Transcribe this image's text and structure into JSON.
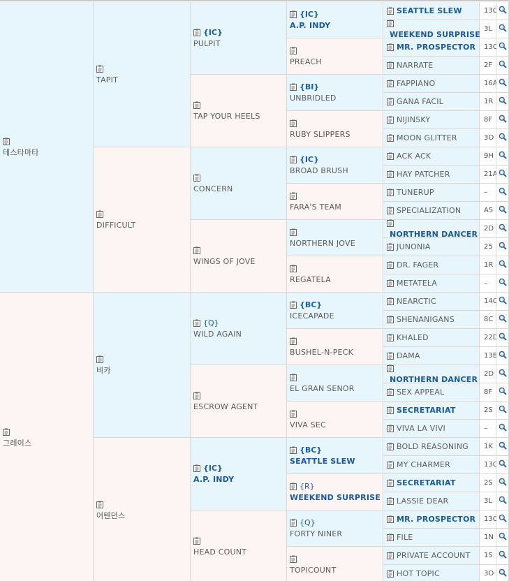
{
  "pedigree": [
    {
      "name": "테스타마타",
      "hl": false,
      "badge": "",
      "children": [
        {
          "name": "TAPIT",
          "hl": false,
          "badge": "",
          "children": [
            {
              "name": "PULPIT",
              "hl": false,
              "badge": "{IC}",
              "children": [
                {
                  "name": "A.P. INDY",
                  "hl": true,
                  "badge": "{IC}",
                  "children": [
                    {
                      "name": "SEATTLE SLEW",
                      "hl": true,
                      "code": "13C"
                    },
                    {
                      "name": "WEEKEND SURPRISE",
                      "hl": true,
                      "code": "3L"
                    }
                  ]
                },
                {
                  "name": "PREACH",
                  "hl": false,
                  "badge": "",
                  "children": [
                    {
                      "name": "MR. PROSPECTOR",
                      "hl": true,
                      "code": "13C"
                    },
                    {
                      "name": "NARRATE",
                      "hl": false,
                      "code": "2F"
                    }
                  ]
                }
              ]
            },
            {
              "name": "TAP YOUR HEELS",
              "hl": false,
              "badge": "",
              "children": [
                {
                  "name": "UNBRIDLED",
                  "hl": false,
                  "badge": "{BI}",
                  "children": [
                    {
                      "name": "FAPPIANO",
                      "hl": false,
                      "code": "16A"
                    },
                    {
                      "name": "GANA FACIL",
                      "hl": false,
                      "code": "1R"
                    }
                  ]
                },
                {
                  "name": "RUBY SLIPPERS",
                  "hl": false,
                  "badge": "",
                  "children": [
                    {
                      "name": "NIJINSKY",
                      "hl": false,
                      "code": "8F"
                    },
                    {
                      "name": "MOON GLITTER",
                      "hl": false,
                      "code": "3O"
                    }
                  ]
                }
              ]
            }
          ]
        },
        {
          "name": "DIFFICULT",
          "hl": false,
          "badge": "",
          "children": [
            {
              "name": "CONCERN",
              "hl": false,
              "badge": "",
              "children": [
                {
                  "name": "BROAD BRUSH",
                  "hl": false,
                  "badge": "{IC}",
                  "children": [
                    {
                      "name": "ACK ACK",
                      "hl": false,
                      "code": "9H"
                    },
                    {
                      "name": "HAY PATCHER",
                      "hl": false,
                      "code": "21A"
                    }
                  ]
                },
                {
                  "name": "FARA'S TEAM",
                  "hl": false,
                  "badge": "",
                  "children": [
                    {
                      "name": "TUNERUP",
                      "hl": false,
                      "code": "–"
                    },
                    {
                      "name": "SPECIALIZATION",
                      "hl": false,
                      "code": "A5"
                    }
                  ]
                }
              ]
            },
            {
              "name": "WINGS OF JOVE",
              "hl": false,
              "badge": "",
              "children": [
                {
                  "name": "NORTHERN JOVE",
                  "hl": false,
                  "badge": "",
                  "children": [
                    {
                      "name": "NORTHERN DANCER",
                      "hl": true,
                      "code": "2D"
                    },
                    {
                      "name": "JUNONIA",
                      "hl": false,
                      "code": "25"
                    }
                  ]
                },
                {
                  "name": "REGATELA",
                  "hl": false,
                  "badge": "",
                  "children": [
                    {
                      "name": "DR. FAGER",
                      "hl": false,
                      "code": "1R"
                    },
                    {
                      "name": "METATELA",
                      "hl": false,
                      "code": "–"
                    }
                  ]
                }
              ]
            }
          ]
        }
      ]
    },
    {
      "name": "그레이스",
      "hl": false,
      "badge": "",
      "children": [
        {
          "name": "비카",
          "hl": false,
          "badge": "",
          "children": [
            {
              "name": "WILD AGAIN",
              "hl": false,
              "badge": "{Q}",
              "light": true,
              "children": [
                {
                  "name": "ICECAPADE",
                  "hl": false,
                  "badge": "{BC}",
                  "children": [
                    {
                      "name": "NEARCTIC",
                      "hl": false,
                      "code": "14C"
                    },
                    {
                      "name": "SHENANIGANS",
                      "hl": false,
                      "code": "8C"
                    }
                  ]
                },
                {
                  "name": "BUSHEL-N-PECK",
                  "hl": false,
                  "badge": "",
                  "children": [
                    {
                      "name": "KHALED",
                      "hl": false,
                      "code": "22D"
                    },
                    {
                      "name": "DAMA",
                      "hl": false,
                      "code": "13E"
                    }
                  ]
                }
              ]
            },
            {
              "name": "ESCROW AGENT",
              "hl": false,
              "badge": "",
              "children": [
                {
                  "name": "EL GRAN SENOR",
                  "hl": false,
                  "badge": "",
                  "children": [
                    {
                      "name": "NORTHERN DANCER",
                      "hl": true,
                      "code": "2D"
                    },
                    {
                      "name": "SEX APPEAL",
                      "hl": false,
                      "code": "8F"
                    }
                  ]
                },
                {
                  "name": "VIVA SEC",
                  "hl": false,
                  "badge": "",
                  "children": [
                    {
                      "name": "SECRETARIAT",
                      "hl": true,
                      "code": "2S"
                    },
                    {
                      "name": "VIVA LA VIVI",
                      "hl": false,
                      "code": "–"
                    }
                  ]
                }
              ]
            }
          ]
        },
        {
          "name": "어텐던스",
          "hl": false,
          "badge": "",
          "children": [
            {
              "name": "A.P. INDY",
              "hl": true,
              "badge": "{IC}",
              "children": [
                {
                  "name": "SEATTLE SLEW",
                  "hl": true,
                  "badge": "{BC}",
                  "children": [
                    {
                      "name": "BOLD REASONING",
                      "hl": false,
                      "code": "1K"
                    },
                    {
                      "name": "MY CHARMER",
                      "hl": false,
                      "code": "13C"
                    }
                  ]
                },
                {
                  "name": "WEEKEND SURPRISE",
                  "hl": true,
                  "badge": "{R}",
                  "light": true,
                  "children": [
                    {
                      "name": "SECRETARIAT",
                      "hl": true,
                      "code": "2S"
                    },
                    {
                      "name": "LASSIE DEAR",
                      "hl": false,
                      "code": "3L"
                    }
                  ]
                }
              ]
            },
            {
              "name": "HEAD COUNT",
              "hl": false,
              "badge": "",
              "children": [
                {
                  "name": "FORTY NINER",
                  "hl": false,
                  "badge": "{Q}",
                  "light": true,
                  "children": [
                    {
                      "name": "MR. PROSPECTOR",
                      "hl": true,
                      "code": "13C"
                    },
                    {
                      "name": "FILE",
                      "hl": false,
                      "code": "1N"
                    }
                  ]
                },
                {
                  "name": "TOPICOUNT",
                  "hl": false,
                  "badge": "",
                  "children": [
                    {
                      "name": "PRIVATE ACCOUNT",
                      "hl": false,
                      "code": "1S"
                    },
                    {
                      "name": "HOT TOPIC",
                      "hl": false,
                      "code": "3O"
                    }
                  ]
                }
              ]
            }
          ]
        }
      ]
    }
  ],
  "icons": {
    "note": "clipboard-icon",
    "search": "magnifier-icon"
  },
  "colors": {
    "highlight": "#1b5aa0",
    "blue_bg": "#e7f6fd",
    "pink_bg": "#fdf4f4",
    "border": "#d8d8d8"
  }
}
